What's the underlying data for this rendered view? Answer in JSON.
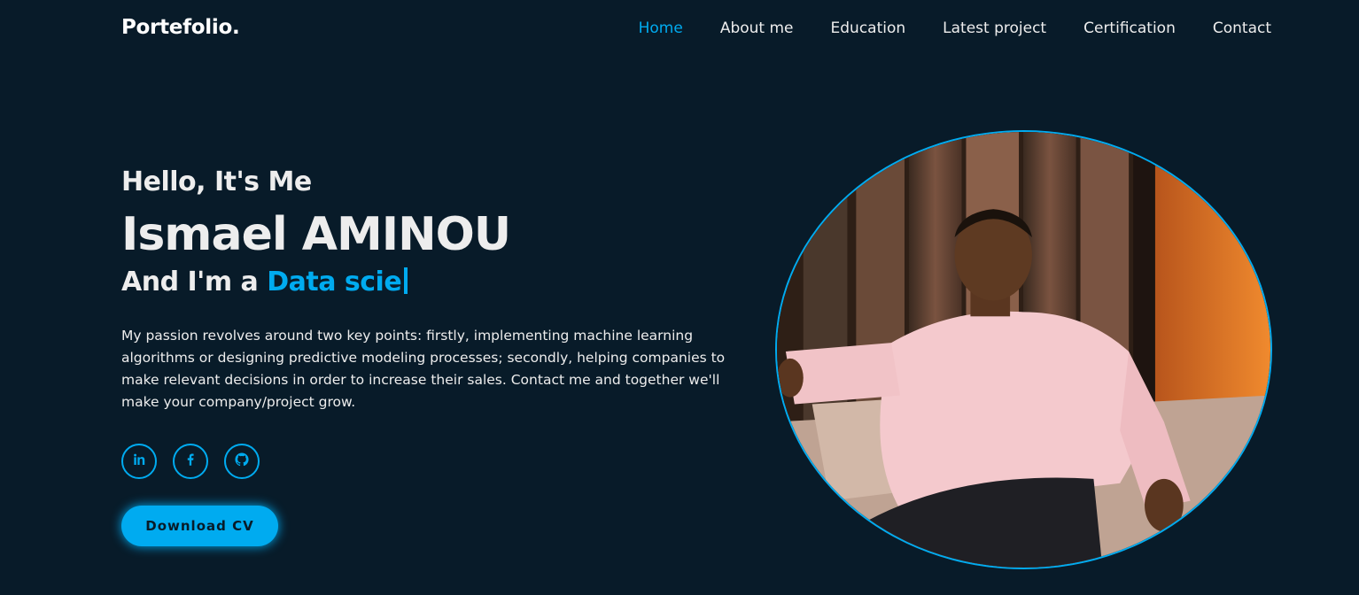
{
  "header": {
    "logo": "Portefolio.",
    "nav": [
      "Home",
      "About me",
      "Education",
      "Latest project",
      "Certification",
      "Contact"
    ]
  },
  "home": {
    "greeting": "Hello, It's Me",
    "name": "Ismael AMINOU",
    "role_prefix": "And I'm a ",
    "role_typed": "Data scie",
    "description": "My passion revolves around two key points: firstly, implementing machine learning algorithms or designing predictive modeling processes; secondly, helping companies to make relevant decisions in order to increase their sales. Contact me and together we'll make your company/project grow.",
    "social": [
      "linkedin-icon",
      "facebook-icon",
      "github-icon"
    ],
    "download_label": "Download CV"
  },
  "colors": {
    "background": "#081b29",
    "accent": "#00abf0",
    "text": "#ededed"
  }
}
